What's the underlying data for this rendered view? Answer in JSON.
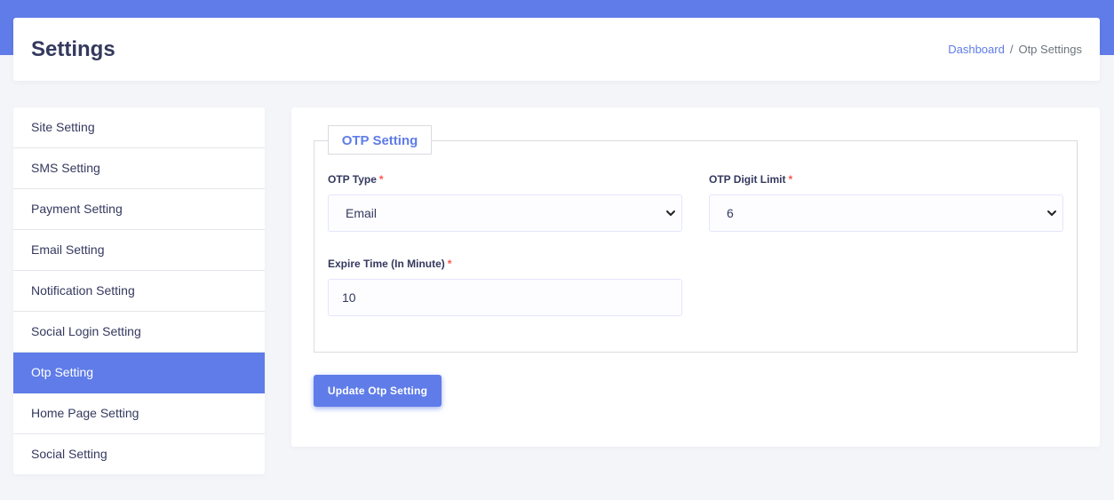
{
  "header": {
    "title": "Settings",
    "breadcrumb": {
      "link": "Dashboard",
      "separator": "/",
      "current": "Otp Settings"
    }
  },
  "sidebar": {
    "items": [
      {
        "label": "Site Setting",
        "active": false
      },
      {
        "label": "SMS Setting",
        "active": false
      },
      {
        "label": "Payment Setting",
        "active": false
      },
      {
        "label": "Email Setting",
        "active": false
      },
      {
        "label": "Notification Setting",
        "active": false
      },
      {
        "label": "Social Login Setting",
        "active": false
      },
      {
        "label": "Otp Setting",
        "active": true
      },
      {
        "label": "Home Page Setting",
        "active": false
      },
      {
        "label": "Social Setting",
        "active": false
      }
    ]
  },
  "form": {
    "legend": "OTP Setting",
    "required_mark": "*",
    "otp_type": {
      "label": "OTP Type",
      "value": "Email"
    },
    "otp_digit_limit": {
      "label": "OTP Digit Limit",
      "value": "6"
    },
    "expire_time": {
      "label": "Expire Time (In Minute)",
      "value": "10"
    },
    "submit_label": "Update Otp Setting"
  },
  "colors": {
    "accent": "#5f7ce8",
    "required": "#fc544b",
    "background": "#f4f5f9",
    "text": "#34395e"
  },
  "icons": {
    "select_arrow": "chevron-down-icon"
  }
}
